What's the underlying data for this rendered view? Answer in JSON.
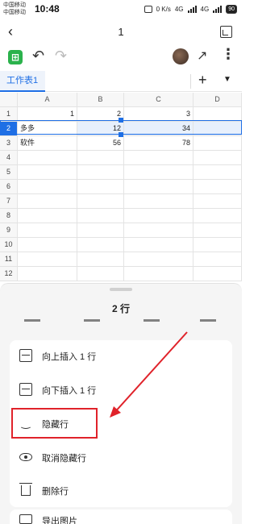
{
  "status": {
    "carrier1": "中国移动",
    "carrier2": "中国移动",
    "time": "10:48",
    "net_speed": "0 K/s",
    "net1": "4G",
    "net2": "4G",
    "battery": "90"
  },
  "titlebar": {
    "title": "1"
  },
  "tabs": {
    "sheet1": "工作表1"
  },
  "grid": {
    "columns": [
      "A",
      "B",
      "C",
      "D"
    ],
    "rows": [
      {
        "num": "1",
        "A": "1",
        "B": "2",
        "C": "3",
        "D": ""
      },
      {
        "num": "2",
        "A": "多多",
        "B": "12",
        "C": "34",
        "D": ""
      },
      {
        "num": "3",
        "A": "软件",
        "B": "56",
        "C": "78",
        "D": ""
      },
      {
        "num": "4"
      },
      {
        "num": "5"
      },
      {
        "num": "6"
      },
      {
        "num": "7"
      },
      {
        "num": "8"
      },
      {
        "num": "9"
      },
      {
        "num": "10"
      },
      {
        "num": "11"
      },
      {
        "num": "12"
      }
    ]
  },
  "panel": {
    "title": "2 行",
    "menu": [
      {
        "label": "向上插入 1 行",
        "icon": "insert-above-icon"
      },
      {
        "label": "向下插入 1 行",
        "icon": "insert-below-icon"
      },
      {
        "label": "隐藏行",
        "icon": "hide-eye-icon"
      },
      {
        "label": "取消隐藏行",
        "icon": "eye-icon"
      },
      {
        "label": "删除行",
        "icon": "trash-icon"
      }
    ],
    "next_item": "导出图片"
  },
  "annotation_color": "#e0222a",
  "accent": "#1f6fe5"
}
